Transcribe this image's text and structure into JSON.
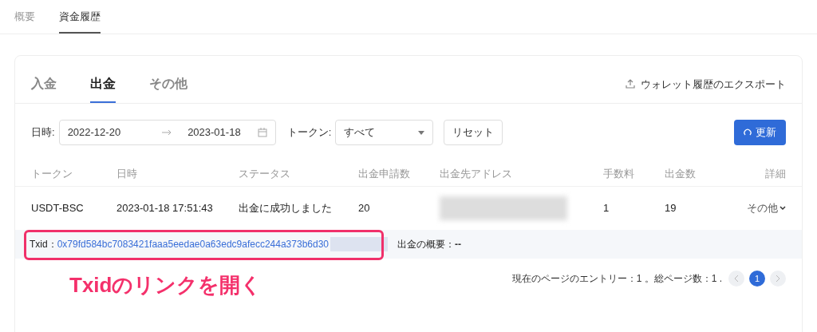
{
  "top_tabs": [
    {
      "label": "概要",
      "selected": false
    },
    {
      "label": "資金履歴",
      "selected": true
    }
  ],
  "card_tabs": [
    {
      "label": "入金",
      "selected": false
    },
    {
      "label": "出金",
      "selected": true
    },
    {
      "label": "その他",
      "selected": false
    }
  ],
  "export_link": "ウォレット履歴のエクスポート",
  "filters": {
    "date_label": "日時:",
    "date_start": "2022-12-20",
    "date_end": "2023-01-18",
    "token_label": "トークン:",
    "token_value": "すべて",
    "reset": "リセット",
    "refresh": "更新"
  },
  "table": {
    "columns": [
      "トークン",
      "日時",
      "ステータス",
      "出金申請数",
      "出金先アドレス",
      "手数料",
      "出金数",
      "詳細"
    ],
    "rows": [
      {
        "token": "USDT-BSC",
        "time": "2023-01-18 17:51:43",
        "status": "出金に成功しました",
        "requested": "20",
        "fee": "1",
        "amount": "19",
        "details": "その他",
        "expanded": true,
        "txid_label": "Txid：",
        "txid": "0x79fd584bc7083421faaa5eedae0a63edc9afecc244a373b6d30",
        "summary_label": "出金の概要：",
        "summary": "--"
      }
    ]
  },
  "pagination": {
    "summary": "現在のページのエントリー：1 。総ページ数：1 .",
    "pages": [
      {
        "label": "1",
        "selected": true
      }
    ]
  },
  "annotation": "Txidのリンクを開く"
}
